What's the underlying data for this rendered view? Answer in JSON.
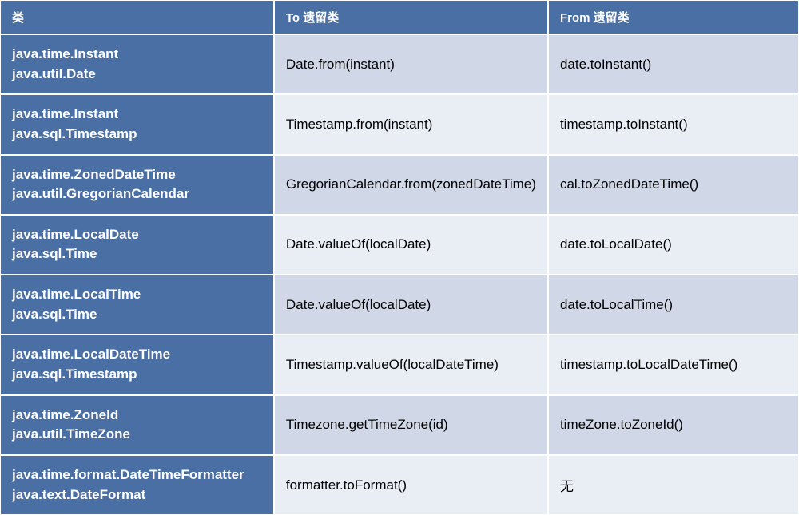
{
  "headers": {
    "col1": "类",
    "col2": "To 遗留类",
    "col3": "From 遗留类"
  },
  "rows": [
    {
      "class_line1": "java.time.Instant",
      "class_line2": "java.util.Date",
      "to": "Date.from(instant)",
      "from": "date.toInstant()"
    },
    {
      "class_line1": "java.time.Instant",
      "class_line2": "java.sql.Timestamp",
      "to": "Timestamp.from(instant)",
      "from": "timestamp.toInstant()"
    },
    {
      "class_line1": "java.time.ZonedDateTime",
      "class_line2": "java.util.GregorianCalendar",
      "to": "GregorianCalendar.from(zonedDateTime)",
      "from": "cal.toZonedDateTime()"
    },
    {
      "class_line1": "java.time.LocalDate",
      "class_line2": "java.sql.Time",
      "to": "Date.valueOf(localDate)",
      "from": "date.toLocalDate()"
    },
    {
      "class_line1": "java.time.LocalTime",
      "class_line2": "java.sql.Time",
      "to": "Date.valueOf(localDate)",
      "from": "date.toLocalTime()"
    },
    {
      "class_line1": "java.time.LocalDateTime",
      "class_line2": "java.sql.Timestamp",
      "to": "Timestamp.valueOf(localDateTime)",
      "from": "timestamp.toLocalDateTime()"
    },
    {
      "class_line1": "java.time.ZoneId",
      "class_line2": "java.util.TimeZone",
      "to": "Timezone.getTimeZone(id)",
      "from": "timeZone.toZoneId()"
    },
    {
      "class_line1": "java.time.format.DateTimeFormatter",
      "class_line2": "java.text.DateFormat",
      "to": "formatter.toFormat()",
      "from": "无"
    }
  ]
}
